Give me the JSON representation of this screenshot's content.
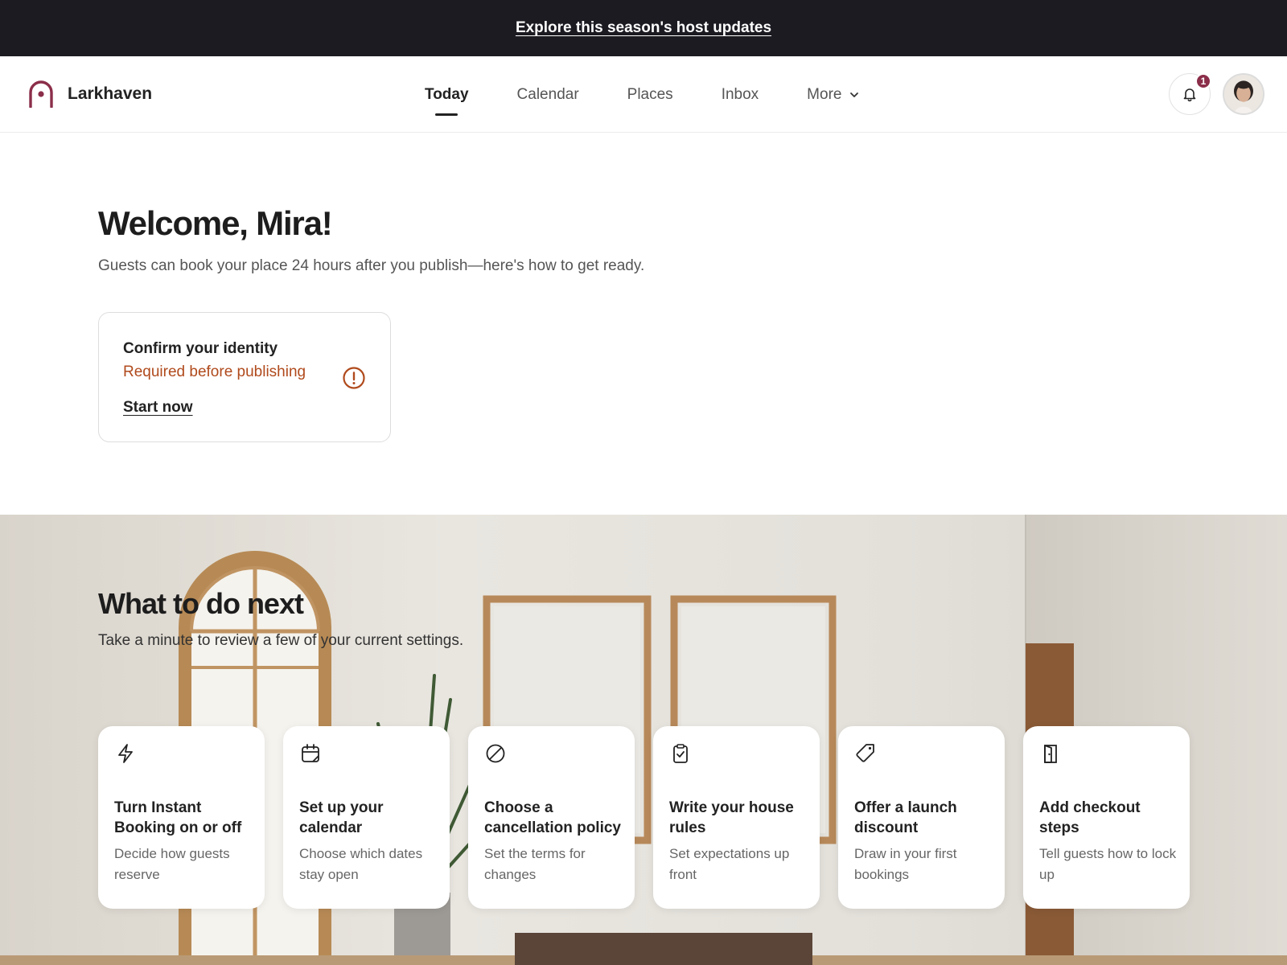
{
  "banner": {
    "link_text": "Explore this season's host updates"
  },
  "brand": {
    "name": "Larkhaven",
    "logo_icon": "arch-logo-icon",
    "accent": "#8b2e4a"
  },
  "nav": {
    "items": [
      {
        "label": "Today",
        "active": true
      },
      {
        "label": "Calendar",
        "active": false
      },
      {
        "label": "Places",
        "active": false
      },
      {
        "label": "Inbox",
        "active": false
      },
      {
        "label": "More",
        "active": false,
        "icon": "chevron-down-icon"
      }
    ]
  },
  "notifications": {
    "icon": "bell-icon",
    "count": "1"
  },
  "welcome": {
    "title": "Welcome, Mira!",
    "subtitle": "Guests can book your place 24 hours after you publish—here's how to get ready."
  },
  "identity_card": {
    "title": "Confirm your identity",
    "status": "Required before publishing",
    "status_color": "#b04a1c",
    "icon": "alert-circle-icon",
    "action": "Start now"
  },
  "next_steps": {
    "title": "What to do next",
    "subtitle": "Take a minute to review a few of your current settings.",
    "cards": [
      {
        "icon": "lightning-icon",
        "title": "Turn Instant Booking on or off",
        "description": "Decide how guests reserve"
      },
      {
        "icon": "calendar-icon",
        "title": "Set up your calendar",
        "description": "Choose which dates stay open"
      },
      {
        "icon": "prohibited-icon",
        "title": "Choose a cancellation policy",
        "description": "Set the terms for changes"
      },
      {
        "icon": "clipboard-check-icon",
        "title": "Write your house rules",
        "description": "Set expectations up front"
      },
      {
        "icon": "tag-icon",
        "title": "Offer a launch discount",
        "description": "Draw in your first bookings"
      },
      {
        "icon": "door-icon",
        "title": "Add checkout steps",
        "description": "Tell guests how to lock up"
      }
    ]
  }
}
